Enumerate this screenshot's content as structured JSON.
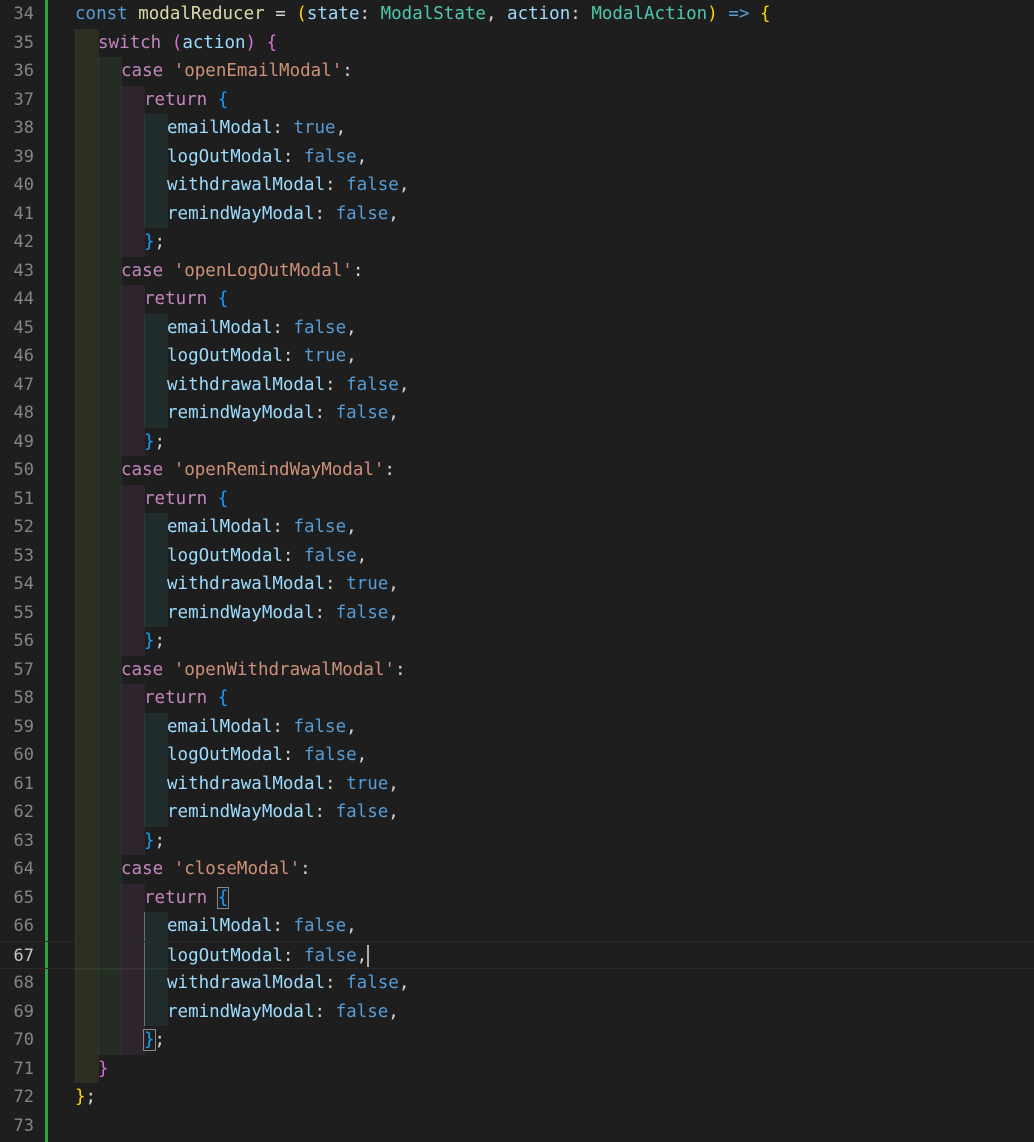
{
  "editor": {
    "line_numbers": [
      "34",
      "35",
      "36",
      "37",
      "38",
      "39",
      "40",
      "41",
      "42",
      "43",
      "44",
      "45",
      "46",
      "47",
      "48",
      "49",
      "50",
      "51",
      "52",
      "53",
      "54",
      "55",
      "56",
      "57",
      "58",
      "59",
      "60",
      "61",
      "62",
      "63",
      "64",
      "65",
      "66",
      "67",
      "68",
      "69",
      "70",
      "71",
      "72",
      "73"
    ],
    "active_line": "67",
    "colors": {
      "background": "#1e1e1e",
      "keyword": "#569cd6",
      "control_keyword": "#c586c0",
      "string": "#ce9178",
      "variable": "#9cdcfe",
      "type": "#4ec9b0",
      "function": "#dcdcaa",
      "git_added": "#2ea043"
    }
  },
  "code": {
    "l34": {
      "kw": "const",
      "name": "modalReducer",
      "eq": " = ",
      "p1": "(",
      "state": "state",
      "colon1": ": ",
      "type1": "ModalState",
      "comma1": ", ",
      "action": "action",
      "colon2": ": ",
      "type2": "ModalAction",
      "p1c": ")",
      "arrow": " => ",
      "brace": "{"
    },
    "l35": {
      "kw": "switch",
      "sp": " ",
      "p1": "(",
      "action": "action",
      "p1c": ")",
      "brace": " {"
    },
    "cases": [
      {
        "kw": "case",
        "label": "'openEmailModal'",
        "colon": ":",
        "ret": "return",
        "open": "{",
        "close": "};",
        "props": [
          {
            "key": "emailModal",
            "val": "true"
          },
          {
            "key": "logOutModal",
            "val": "false"
          },
          {
            "key": "withdrawalModal",
            "val": "false"
          },
          {
            "key": "remindWayModal",
            "val": "false"
          }
        ]
      },
      {
        "kw": "case",
        "label": "'openLogOutModal'",
        "colon": ":",
        "ret": "return",
        "open": "{",
        "close": "};",
        "props": [
          {
            "key": "emailModal",
            "val": "false"
          },
          {
            "key": "logOutModal",
            "val": "true"
          },
          {
            "key": "withdrawalModal",
            "val": "false"
          },
          {
            "key": "remindWayModal",
            "val": "false"
          }
        ]
      },
      {
        "kw": "case",
        "label": "'openRemindWayModal'",
        "colon": ":",
        "ret": "return",
        "open": "{",
        "close": "};",
        "props": [
          {
            "key": "emailModal",
            "val": "false"
          },
          {
            "key": "logOutModal",
            "val": "false"
          },
          {
            "key": "withdrawalModal",
            "val": "true"
          },
          {
            "key": "remindWayModal",
            "val": "false"
          }
        ]
      },
      {
        "kw": "case",
        "label": "'openWithdrawalModal'",
        "colon": ":",
        "ret": "return",
        "open": "{",
        "close": "};",
        "props": [
          {
            "key": "emailModal",
            "val": "false"
          },
          {
            "key": "logOutModal",
            "val": "false"
          },
          {
            "key": "withdrawalModal",
            "val": "true"
          },
          {
            "key": "remindWayModal",
            "val": "false"
          }
        ]
      },
      {
        "kw": "case",
        "label": "'closeModal'",
        "colon": ":",
        "ret": "return",
        "open": "{",
        "close": "};",
        "props": [
          {
            "key": "emailModal",
            "val": "false"
          },
          {
            "key": "logOutModal",
            "val": "false"
          },
          {
            "key": "withdrawalModal",
            "val": "false"
          },
          {
            "key": "remindWayModal",
            "val": "false"
          }
        ]
      }
    ],
    "l71": {
      "brace": "}"
    },
    "l72": {
      "brace": "}",
      "semi": ";"
    }
  }
}
